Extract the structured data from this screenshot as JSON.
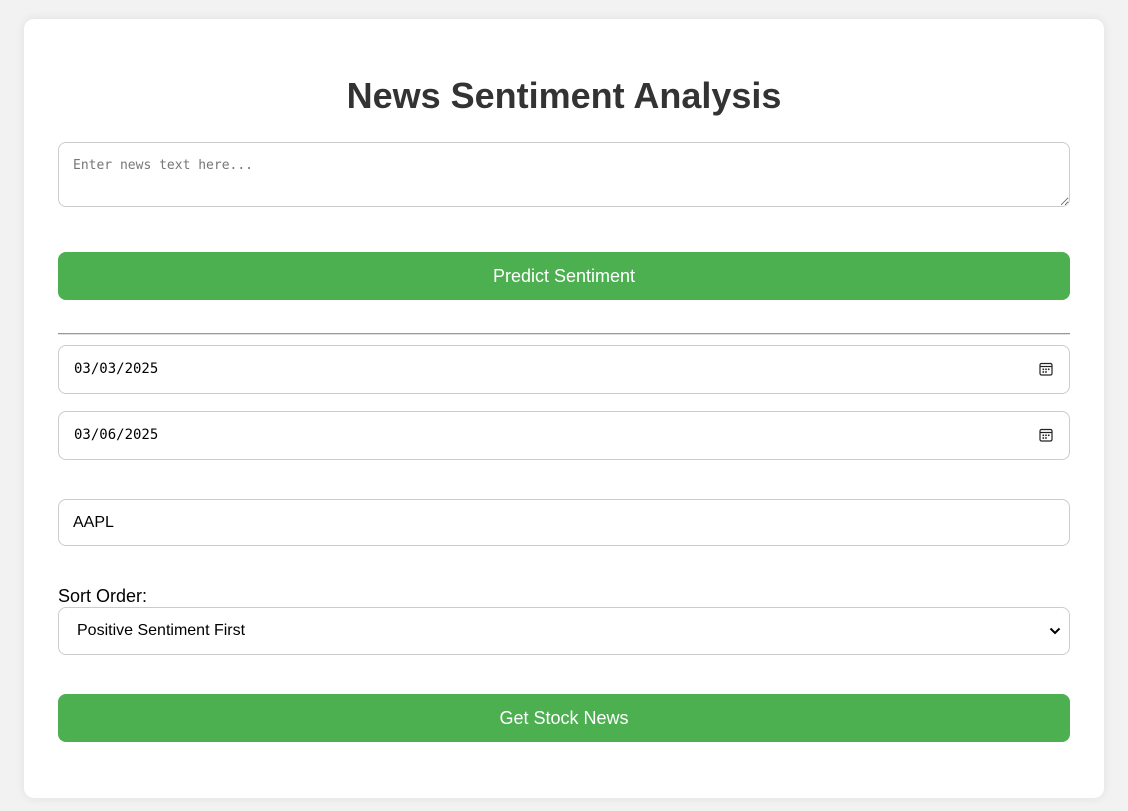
{
  "header": {
    "title": "News Sentiment Analysis"
  },
  "predict": {
    "news_placeholder": "Enter news text here...",
    "news_value": "",
    "button_label": "Predict Sentiment"
  },
  "stock": {
    "start_date": "03/03/2025",
    "end_date": "03/06/2025",
    "ticker": "AAPL",
    "sort_label": "Sort Order:",
    "sort_selected": "Positive Sentiment First",
    "button_label": "Get Stock News"
  },
  "icons": {
    "calendar": "calendar-icon",
    "dropdown": "chevron-down-icon"
  },
  "colors": {
    "accent": "#4caf50",
    "title": "#333333",
    "background": "#f2f2f2"
  }
}
